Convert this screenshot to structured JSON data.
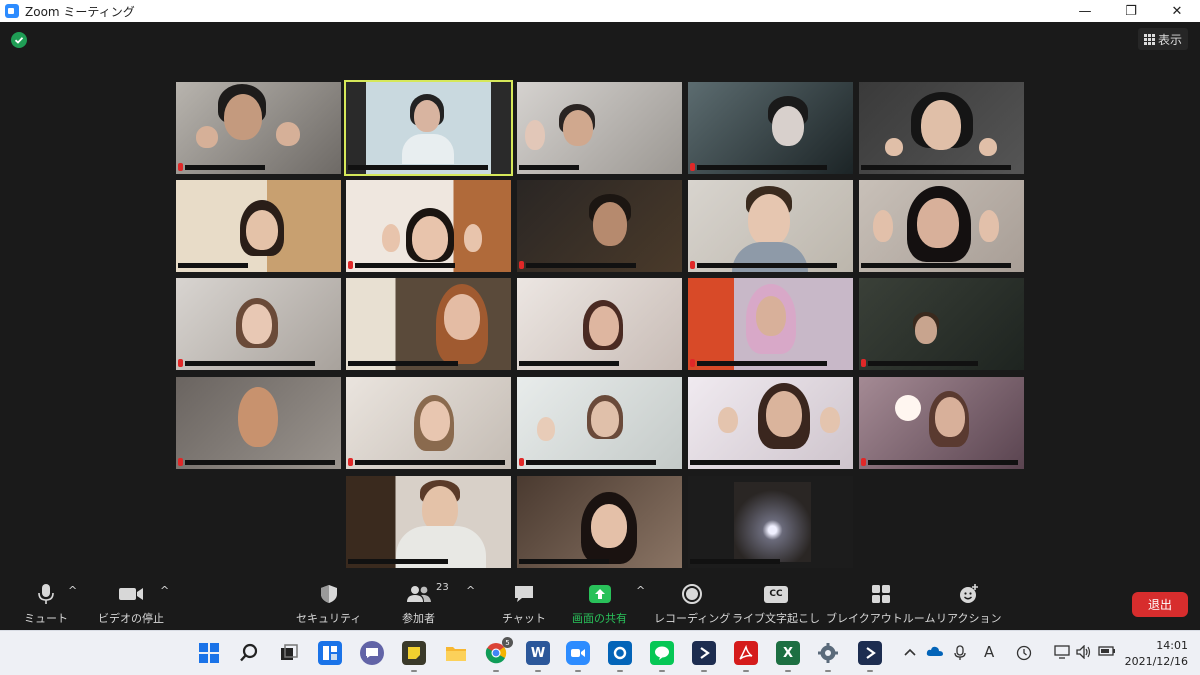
{
  "window": {
    "title": "Zoom ミーティング",
    "minimize": "—",
    "restore": "❐",
    "close": "✕"
  },
  "meeting": {
    "view_label": "表示"
  },
  "toolbar": {
    "mute": "ミュート",
    "video": "ビデオの停止",
    "security": "セキュリティ",
    "participants": "参加者",
    "participants_count": "23",
    "chat": "チャット",
    "share": "画面の共有",
    "record": "レコーディング",
    "captions": "ライブ文字起こし",
    "captions_icon_text": "CC",
    "breakout": "ブレイクアウトルーム",
    "reactions": "リアクション",
    "leave": "退出",
    "caret": "^"
  },
  "taskbar": {
    "chrome_badge": "5",
    "word_glyph": "W",
    "excel_glyph": "X",
    "ime_glyph": "A",
    "time": "14:01",
    "date": "2021/12/16"
  },
  "colors": {
    "share_green": "#29c15a",
    "leave_red": "#d72d2d",
    "active_speaker": "#d6e85a",
    "zoom_blue": "#2D8CFF"
  }
}
